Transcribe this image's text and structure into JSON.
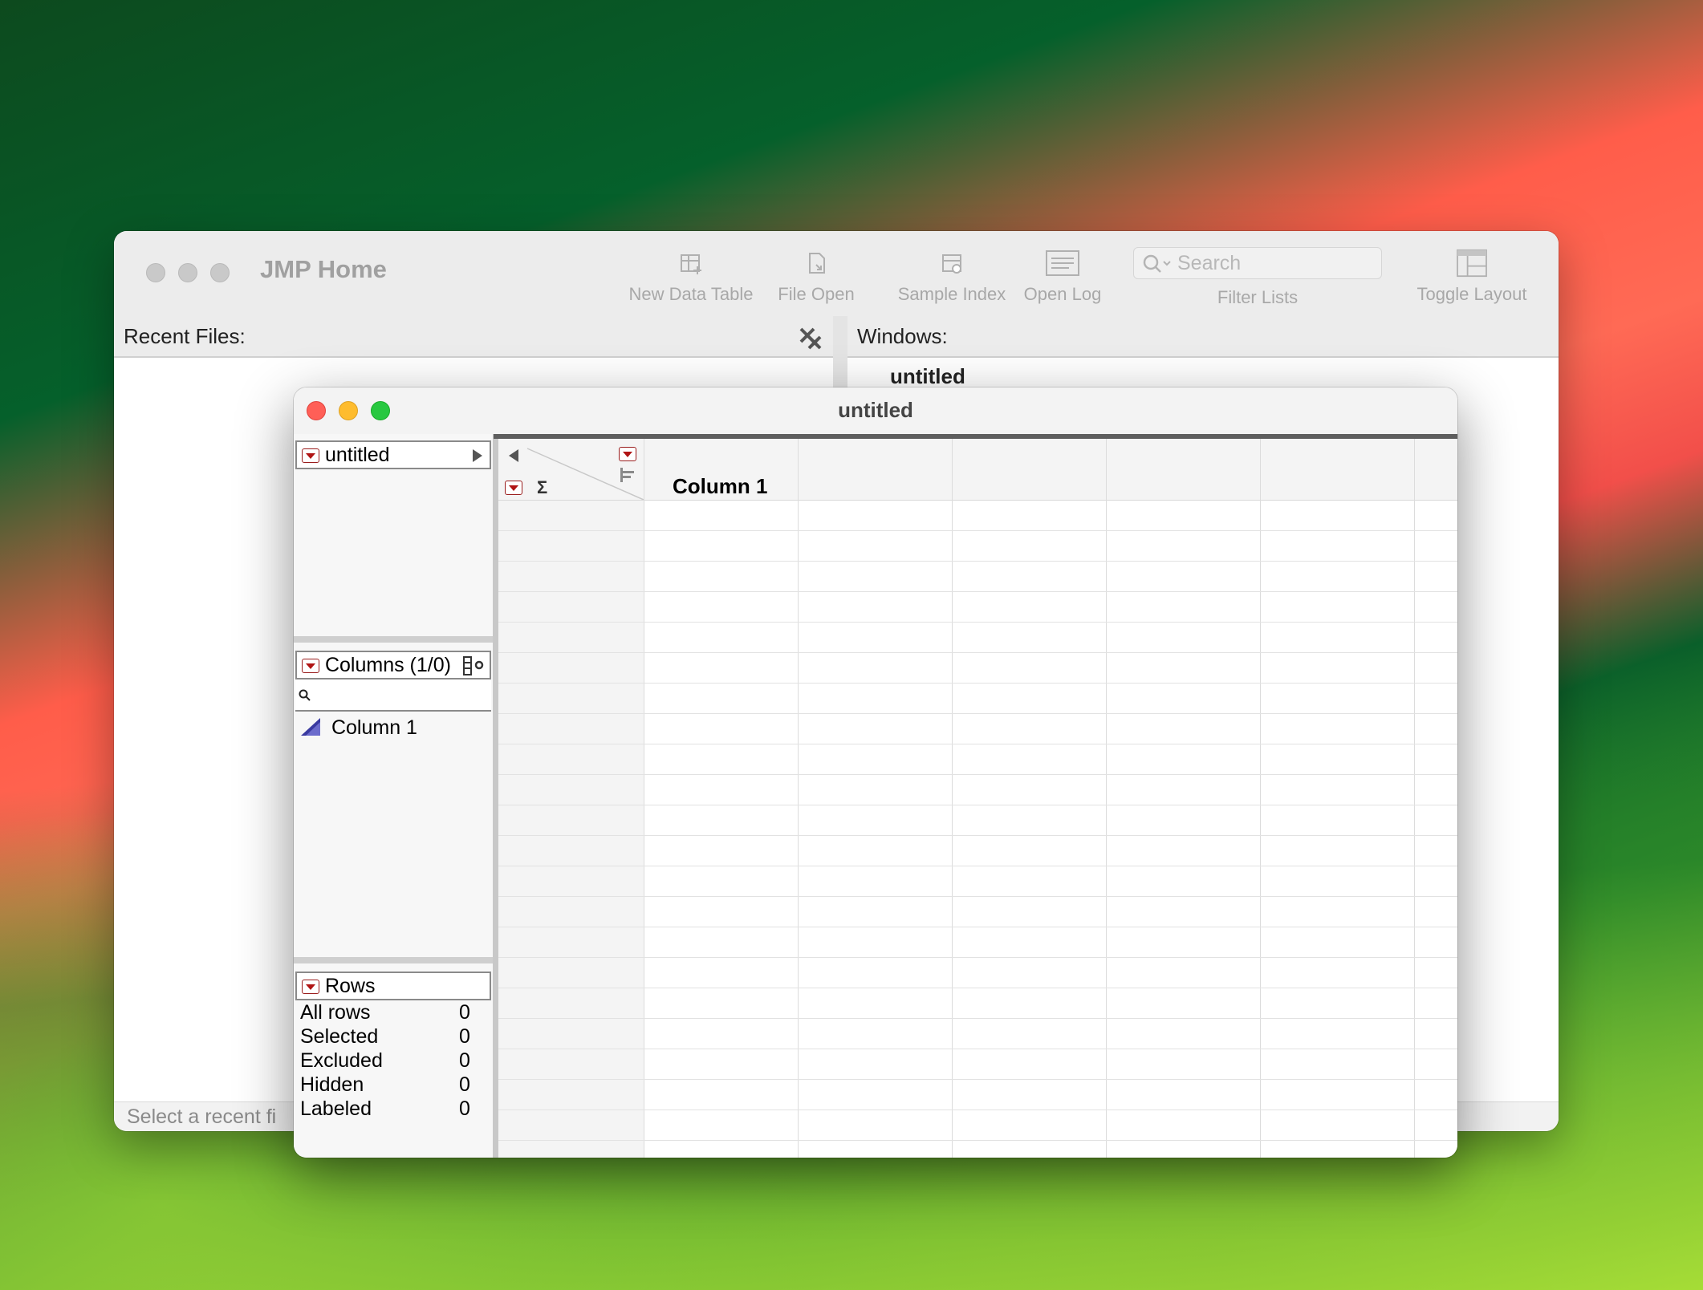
{
  "home_window": {
    "title": "JMP Home",
    "toolbar": {
      "new_data_table": "New Data Table",
      "file_open": "File Open",
      "sample_index": "Sample Index",
      "open_log": "Open Log",
      "search_placeholder": "Search",
      "filter_lists": "Filter Lists",
      "toggle_layout": "Toggle Layout"
    },
    "recent_files_label": "Recent Files:",
    "windows_label": "Windows:",
    "windows_items": [
      "untitled"
    ],
    "status_text": "Select a recent fi"
  },
  "data_table_window": {
    "title": "untitled",
    "table_panel_label": "untitled",
    "columns_panel_label": "Columns (1/0)",
    "columns": [
      {
        "name": "Column 1"
      }
    ],
    "rows_panel_label": "Rows",
    "row_states": [
      {
        "label": "All rows",
        "value": "0"
      },
      {
        "label": "Selected",
        "value": "0"
      },
      {
        "label": "Excluded",
        "value": "0"
      },
      {
        "label": "Hidden",
        "value": "0"
      },
      {
        "label": "Labeled",
        "value": "0"
      }
    ],
    "grid_headers": [
      "Column 1"
    ],
    "sigma": "Σ"
  },
  "colors": {
    "close": "#ff5f57",
    "minimize": "#febc2e",
    "maximize": "#28c840",
    "red_accent": "#b01414"
  }
}
